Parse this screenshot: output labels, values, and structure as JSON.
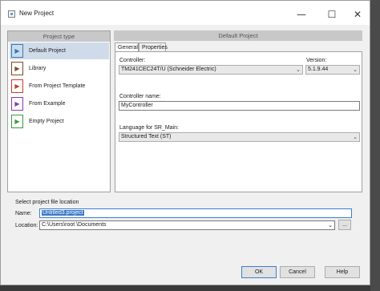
{
  "window": {
    "title": "New Project"
  },
  "controls": {
    "minimize": "—",
    "maximize": "☐",
    "close": "✕"
  },
  "left_panel": {
    "header": "Project type",
    "items": [
      {
        "label": "Default Project",
        "icon": "default-project-icon",
        "glyph": "▶",
        "color": "#2e7bbf"
      },
      {
        "label": "Library",
        "icon": "library-icon",
        "glyph": "▶",
        "color": "#7a4a2a"
      },
      {
        "label": "From Project Template",
        "icon": "template-icon",
        "glyph": "▶",
        "color": "#c2402e"
      },
      {
        "label": "From Example",
        "icon": "example-icon",
        "glyph": "▶",
        "color": "#8a3aa8"
      },
      {
        "label": "Empty Project",
        "icon": "empty-project-icon",
        "glyph": "▶",
        "color": "#3a9a3a"
      }
    ]
  },
  "right_panel": {
    "header": "Default Project",
    "tabs": [
      "General",
      "Properties"
    ],
    "controller_label": "Controller:",
    "controller_value": "TM241CEC24T/U (Schneider Electric)",
    "version_label": "Version:",
    "version_value": "5.1.9.44",
    "name_label": "Controller name:",
    "name_value": "MyController",
    "language_label": "Language for SR_Main:",
    "language_value": "Structured Text (ST)"
  },
  "location": {
    "group_title": "Select project file location",
    "name_label": "Name:",
    "name_value": "Untitled3.project",
    "location_label": "Location:",
    "location_value": "C:\\Users\\root \\Documents",
    "browse": "..."
  },
  "buttons": {
    "ok": "OK",
    "cancel": "Cancel",
    "help": "Help"
  }
}
